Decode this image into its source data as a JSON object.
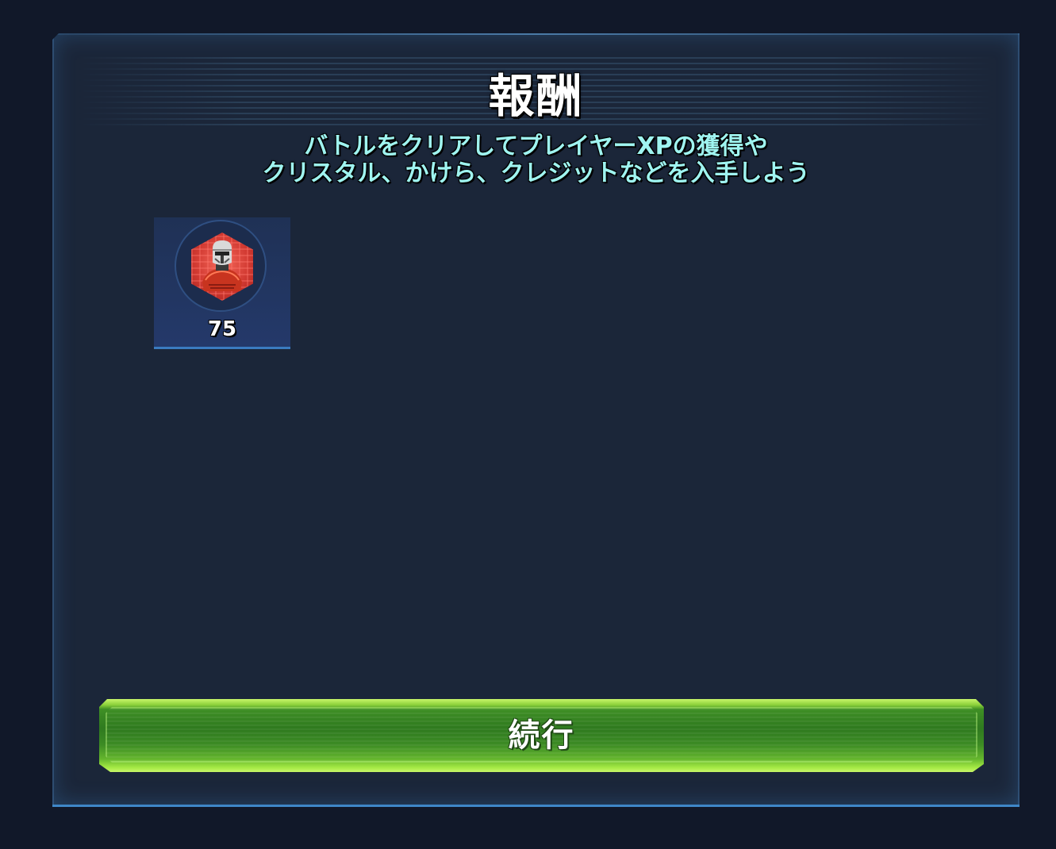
{
  "dialog": {
    "title": "報酬",
    "subtitle_lines": [
      "バトルをクリアしてプレイヤーXPの獲得や",
      "クリスタル、かけら、クレジットなどを入手しよう"
    ]
  },
  "rewards": [
    {
      "icon": "trooper-shard-icon",
      "quantity": "75"
    }
  ],
  "continue_button": {
    "label": "続行"
  },
  "colors": {
    "background": "#111829",
    "panel": "#1b2639",
    "subtitle_text": "#9ff4f0",
    "button_green": "#5fb52d",
    "accent_blue": "#3f87c8",
    "shard_red": "#d23a32"
  }
}
